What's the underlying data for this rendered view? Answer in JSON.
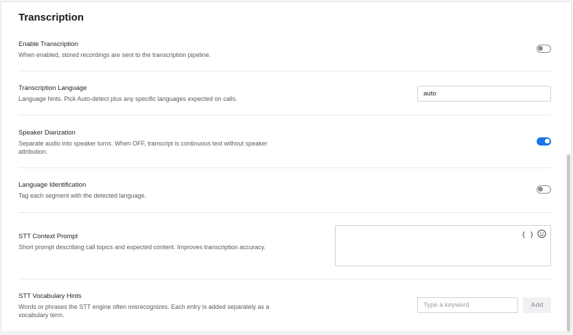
{
  "section": {
    "title": "Transcription"
  },
  "settings": {
    "enable_transcription": {
      "label": "Enable Transcription",
      "description": "When enabled, stored recordings are sent to the transcription pipeline.",
      "enabled": false
    },
    "transcription_language": {
      "label": "Transcription Language",
      "description": "Language hints. Pick Auto-detect plus any specific languages expected on calls.",
      "value": "auto"
    },
    "speaker_diarization": {
      "label": "Speaker Diarization",
      "description": "Separate audio into speaker turns. When OFF, transcript is continuous text without speaker attribution.",
      "enabled": true
    },
    "language_identification": {
      "label": "Language Identification",
      "description": "Tag each segment with the detected language.",
      "enabled": false
    },
    "stt_context_prompt": {
      "label": "STT Context Prompt",
      "description": "Short prompt describing call topics and expected content. Improves transcription accuracy.",
      "value": "",
      "icons": {
        "braces": "{ }",
        "emoji": "emoji-icon"
      }
    },
    "stt_vocabulary_hints": {
      "label": "STT Vocabulary Hints",
      "description": "Words or phrases the STT engine often misrecognizes. Each entry is added separately as a vocabulary term.",
      "placeholder": "Type a keyword",
      "add_label": "Add"
    }
  },
  "colors": {
    "accent": "#1a73e8",
    "toggle_off": "#8a8a8a"
  }
}
